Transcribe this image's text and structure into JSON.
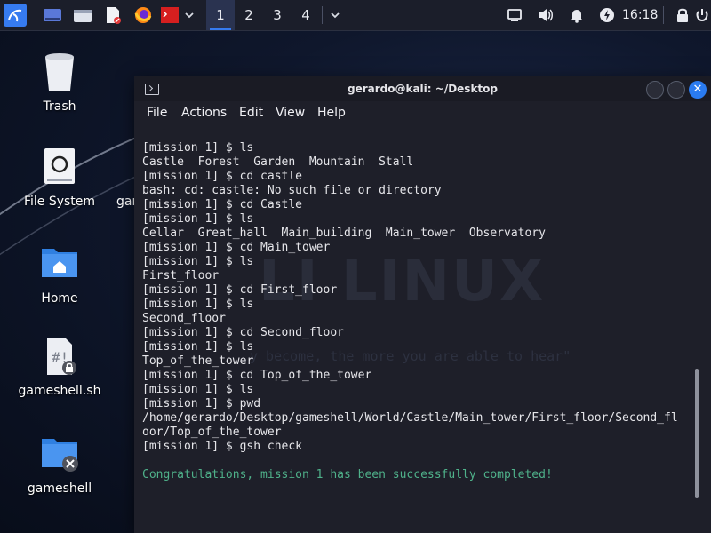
{
  "taskbar": {
    "launchers": [
      {
        "name": "kali-menu-icon"
      },
      {
        "name": "show-desktop-icon"
      },
      {
        "name": "file-manager-icon"
      },
      {
        "name": "text-editor-icon"
      },
      {
        "name": "firefox-icon"
      },
      {
        "name": "terminal-icon"
      }
    ],
    "workspaces": [
      "1",
      "2",
      "3",
      "4"
    ],
    "active_workspace": 0,
    "clock": "16:18"
  },
  "desktop": {
    "icons": [
      {
        "label": "Trash"
      },
      {
        "label": "File System"
      },
      {
        "label": "Home"
      },
      {
        "label": "gameshell.sh"
      },
      {
        "label": "gameshell"
      }
    ],
    "clipped_label": "gar"
  },
  "terminal": {
    "title": "gerardo@kali: ~/Desktop",
    "menu": [
      "File",
      "Actions",
      "Edit",
      "View",
      "Help"
    ],
    "watermark": "LI LINUX",
    "watermark_quote": "y become, the more you are able to hear\"",
    "lines": [
      "[mission 1] $ ls",
      "Castle  Forest  Garden  Mountain  Stall",
      "[mission 1] $ cd castle",
      "bash: cd: castle: No such file or directory",
      "[mission 1] $ cd Castle",
      "[mission 1] $ ls",
      "Cellar  Great_hall  Main_building  Main_tower  Observatory",
      "[mission 1] $ cd Main_tower",
      "[mission 1] $ ls",
      "First_floor",
      "[mission 1] $ cd First_floor",
      "[mission 1] $ ls",
      "Second_floor",
      "[mission 1] $ cd Second_floor",
      "[mission 1] $ ls",
      "Top_of_the_tower",
      "[mission 1] $ cd Top_of_the_tower",
      "[mission 1] $ ls",
      "[mission 1] $ pwd",
      "/home/gerardo/Desktop/gameshell/World/Castle/Main_tower/First_floor/Second_fl",
      "oor/Top_of_the_tower",
      "[mission 1] $ gsh check",
      "",
      "Congratulations, mission 1 has been successfully completed!"
    ]
  },
  "colors": {
    "accent": "#367bf0",
    "success_text": "#4fb18a",
    "terminal_bg": "#1e1f29"
  }
}
